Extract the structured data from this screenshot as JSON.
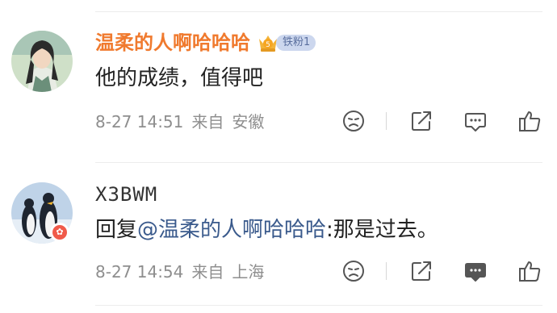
{
  "comments": [
    {
      "username": "温柔的人啊哈哈哈",
      "fan_badge": {
        "label": "铁粉1",
        "level_icon_text": "5"
      },
      "text": "他的成绩，值得吧",
      "timestamp": "8-27 14:51",
      "source": "来自",
      "location": "安徽",
      "actions": [
        "dislike-icon",
        "share-icon",
        "reply-icon",
        "like-icon"
      ]
    },
    {
      "username": "X3BWM",
      "avatar_badge_icon": "vip-star-icon",
      "reply_prefix": "回复",
      "mention": "@温柔的人啊哈哈哈",
      "text": ":那是过去。",
      "timestamp": "8-27 14:54",
      "source": "来自",
      "location": "上海",
      "actions": [
        "dislike-icon",
        "share-icon",
        "reply-icon",
        "like-icon"
      ]
    }
  ],
  "colors": {
    "username_highlight": "#f07a2e",
    "mention": "#3a5a8c",
    "meta_text": "#8e8e8e",
    "fan_badge_bg": "#ccd7ee",
    "avatar_badge": "#f05a4a"
  }
}
